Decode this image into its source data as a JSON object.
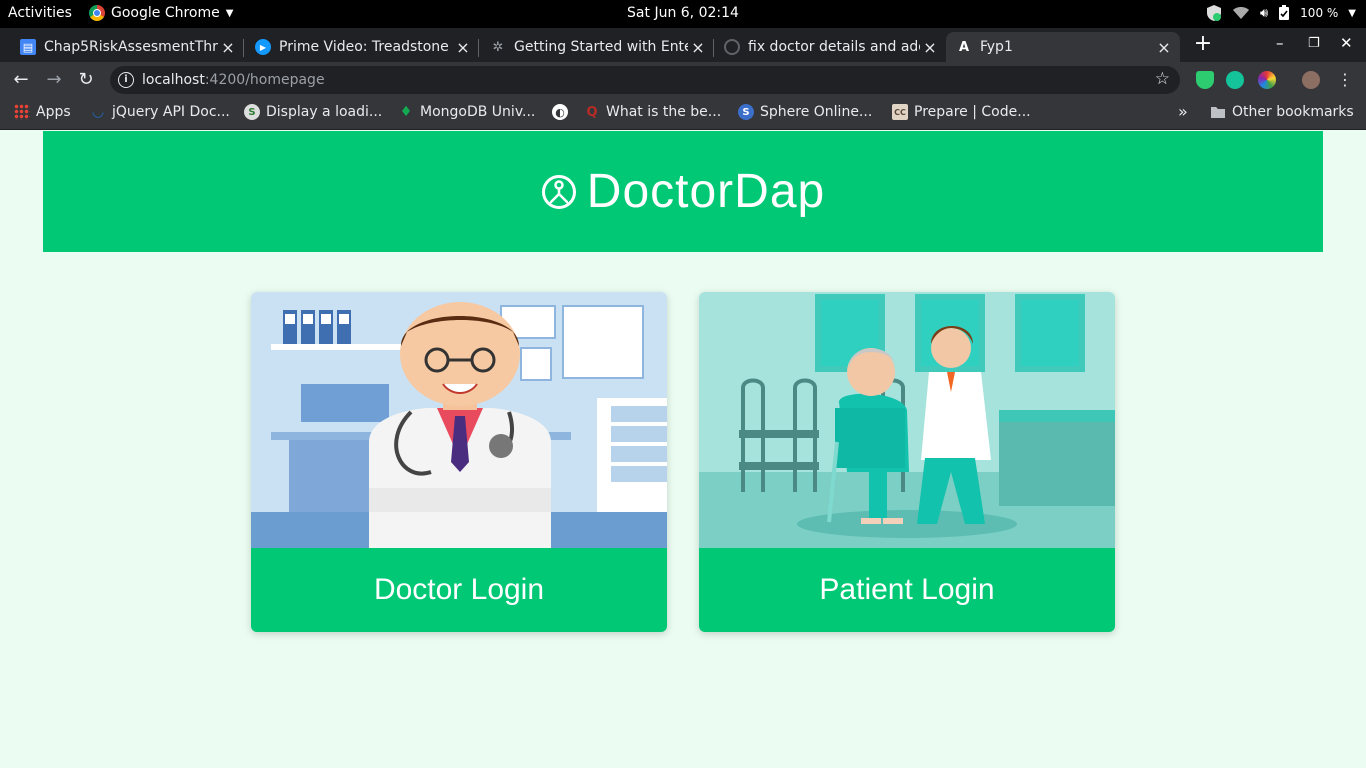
{
  "topbar": {
    "activities": "Activities",
    "app_name": "Google Chrome",
    "clock": "Sat Jun  6, 02:14",
    "battery": "100 %"
  },
  "tabs": [
    {
      "title": "Chap5RiskAssesmentThr",
      "icon": "google-docs-icon",
      "color": "#4285f4"
    },
    {
      "title": "Prime Video: Treadstone",
      "icon": "prime-video-icon",
      "color": "#1399ff"
    },
    {
      "title": "Getting Started with Ente",
      "icon": "bee-icon",
      "color": "#9aa0a6"
    },
    {
      "title": "fix doctor details and add",
      "icon": "github-icon",
      "color": "#9aa0a6"
    },
    {
      "title": "Fyp1",
      "icon": "angular-icon",
      "color": "#ffffff"
    }
  ],
  "toolbar": {
    "url_host": "localhost",
    "url_rest": ":4200/homepage"
  },
  "bookmarks": {
    "items": [
      {
        "label": "Apps",
        "icon": "apps-grid-icon"
      },
      {
        "label": "jQuery API Doc...",
        "icon": "jquery-icon"
      },
      {
        "label": "Display a loadi...",
        "icon": "stackblitz-icon"
      },
      {
        "label": "MongoDB Univ...",
        "icon": "mongodb-leaf-icon"
      },
      {
        "label": "",
        "icon": "globe-icon"
      },
      {
        "label": "What is the be...",
        "icon": "quora-icon"
      },
      {
        "label": "Sphere Online...",
        "icon": "spoj-icon"
      },
      {
        "label": "Prepare | Code...",
        "icon": "codechef-icon"
      }
    ],
    "overflow": "»",
    "other": "Other bookmarks"
  },
  "page": {
    "brand": "DoctorDap",
    "accent": "#00c875",
    "background": "#ebfdf2",
    "cards": [
      {
        "label": "Doctor Login",
        "image": "doctor-illustration"
      },
      {
        "label": "Patient Login",
        "image": "patient-illustration"
      }
    ]
  }
}
